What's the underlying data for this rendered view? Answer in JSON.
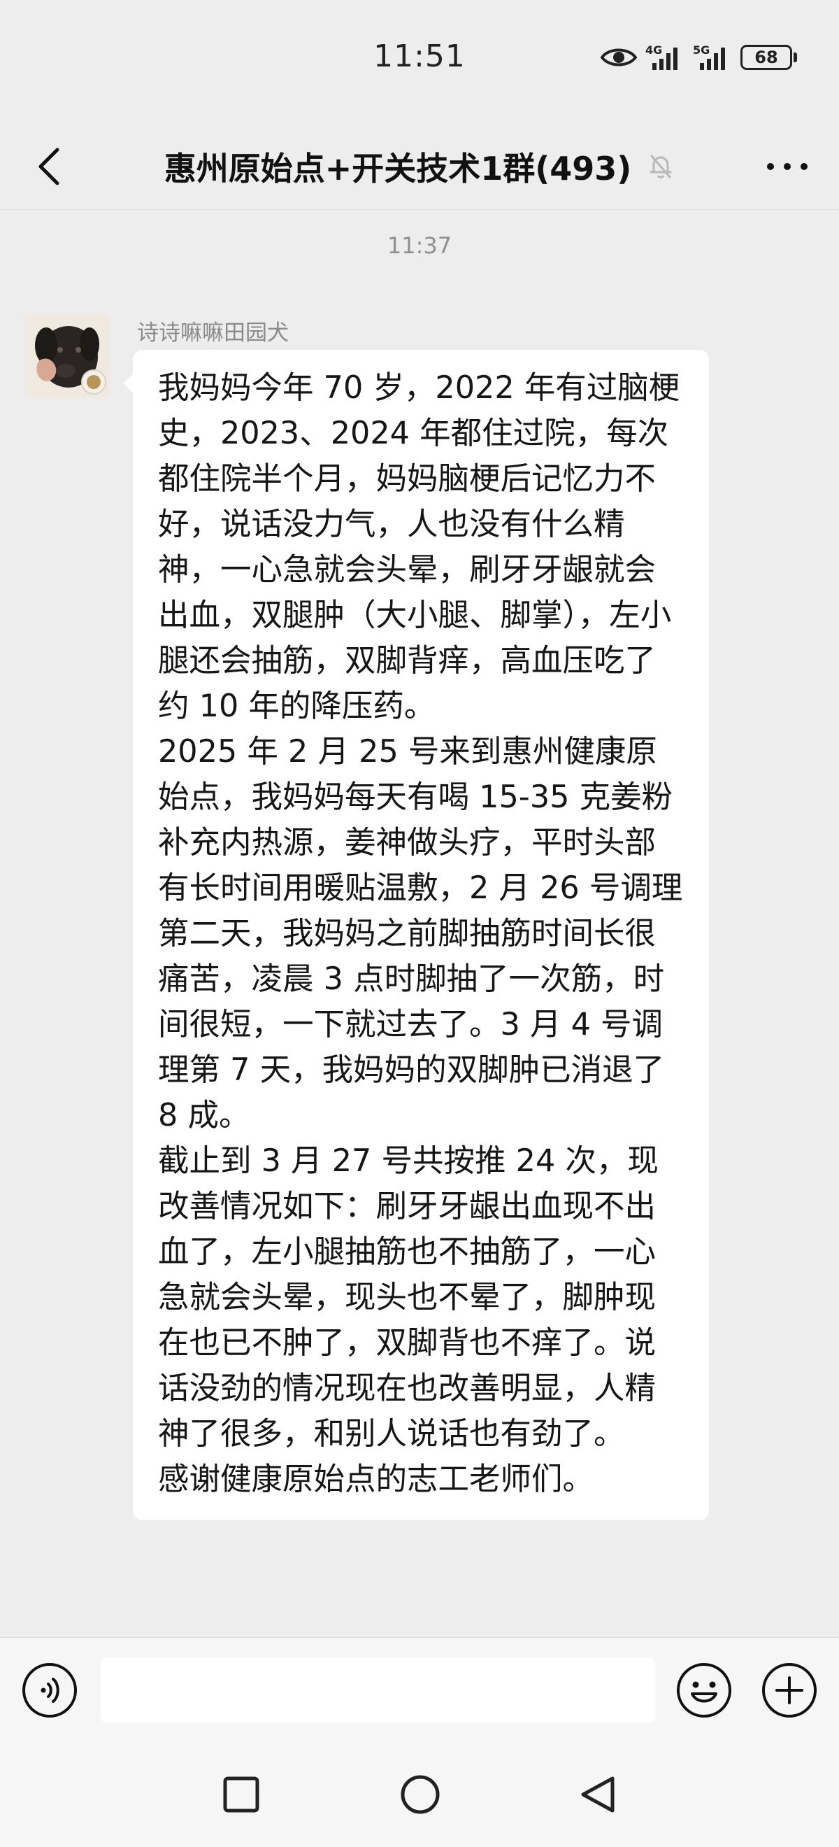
{
  "status_bar": {
    "time": "11:51",
    "network_1": "4G",
    "network_2": "5G",
    "battery": "68"
  },
  "header": {
    "title": "惠州原始点+开关技术1群(493)",
    "back_icon": "chevron-left-icon",
    "mute_icon": "bell-off-icon",
    "more_icon": "more-dots-icon"
  },
  "chat": {
    "time_divider": "11:37",
    "message": {
      "sender": "诗诗嘛嘛田园犬",
      "text": "我妈妈今年 70 岁，2022 年有过脑梗史，2023、2024 年都住过院，每次都住院半个月，妈妈脑梗后记忆力不好，说话没力气，人也没有什么精神，一心急就会头晕，刷牙牙龈就会出血，双腿肿（大小腿、脚掌），左小腿还会抽筋，双脚背痒，高血压吃了约 10 年的降压药。\n2025 年 2 月 25 号来到惠州健康原始点，我妈妈每天有喝 15-35 克姜粉补充内热源，姜神做头疗，平时头部有长时间用暖贴温敷，2 月 26 号调理第二天，我妈妈之前脚抽筋时间长很痛苦，凌晨 3 点时脚抽了一次筋，时间很短，一下就过去了。3 月 4 号调理第 7 天，我妈妈的双脚肿已消退了 8 成。\n截止到 3 月 27 号共按推 24 次，现改善情况如下：刷牙牙龈出血现不出血了，左小腿抽筋也不抽筋了，一心急就会头晕，现头也不晕了，脚肿现在也已不肿了，双脚背也不痒了。说话没劲的情况现在也改善明显，人精神了很多，和别人说话也有劲了。\n感谢健康原始点的志工老师们。"
    }
  },
  "input_bar": {
    "input_value": "",
    "voice_icon": "voice-icon",
    "emoji_icon": "emoji-icon",
    "plus_icon": "plus-icon"
  },
  "system_nav": {
    "recent_icon": "square-icon",
    "home_icon": "circle-icon",
    "back_icon": "triangle-back-icon"
  }
}
